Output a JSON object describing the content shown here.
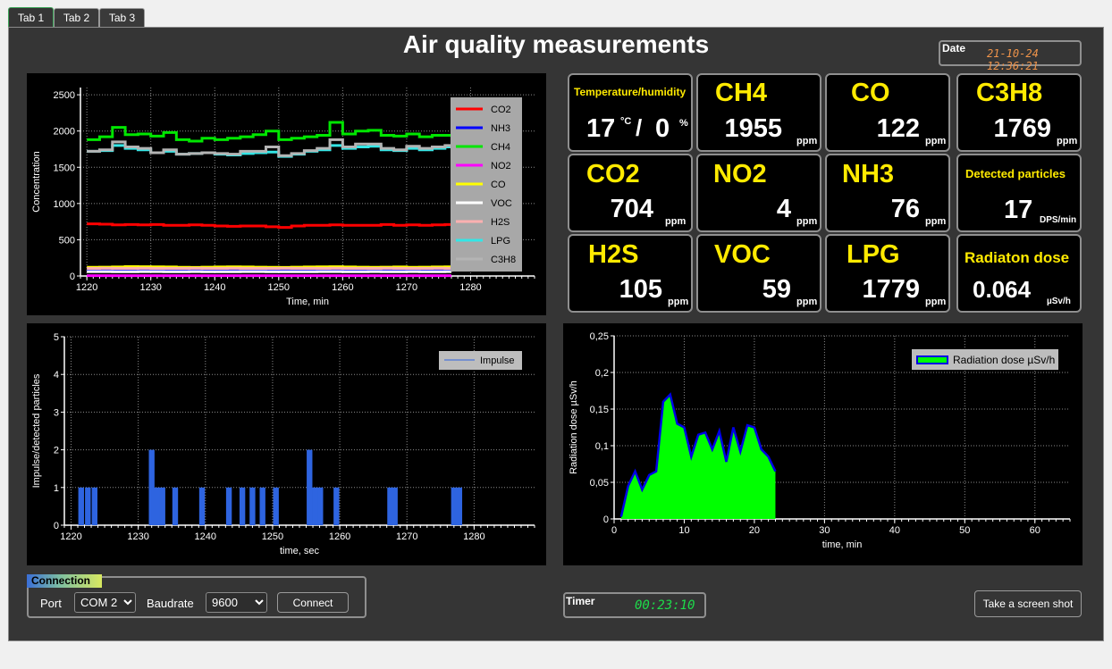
{
  "tabs": [
    {
      "label": "Tab 1"
    },
    {
      "label": "Tab 2"
    },
    {
      "label": "Tab 3"
    }
  ],
  "title": "Air quality measurements",
  "date": {
    "label": "Date",
    "value": "21-10-24 12:36:21",
    "color": "#f0944a"
  },
  "tiles": [
    {
      "name": "CH4",
      "value": "1955",
      "unit": "ppm"
    },
    {
      "name": "CO",
      "value": "122",
      "unit": "ppm"
    },
    {
      "name": "C3H8",
      "value": "1769",
      "unit": "ppm"
    },
    {
      "name": "CO2",
      "value": "704",
      "unit": "ppm"
    },
    {
      "name": "NO2",
      "value": "4",
      "unit": "ppm"
    },
    {
      "name": "NH3",
      "value": "76",
      "unit": "ppm"
    },
    {
      "name": "H2S",
      "value": "105",
      "unit": "ppm"
    },
    {
      "name": "VOC",
      "value": "59",
      "unit": "ppm"
    },
    {
      "name": "LPG",
      "value": "1779",
      "unit": "ppm"
    }
  ],
  "temperature": {
    "label": "Temperature/humidity",
    "temp": "17",
    "temp_unit": "°C",
    "sep": "/",
    "hum": "0",
    "hum_unit": "%"
  },
  "particles": {
    "label": "Detected particles",
    "value": "17",
    "unit": "DPS/min"
  },
  "radiation": {
    "label": "Radiaton dose",
    "value": "0.064",
    "unit": "µSv/h"
  },
  "connection": {
    "title": "Connection",
    "port_label": "Port",
    "port_value": "COM 2",
    "baud_label": "Baudrate",
    "baud_value": "9600",
    "connect_label": "Connect"
  },
  "timer": {
    "label": "Timer",
    "value": "00:23:10",
    "color": "#1ddc4a"
  },
  "screenshot_label": "Take  a screen  shot",
  "chart_data": [
    {
      "type": "line",
      "title": "",
      "xlabel": "Time, min",
      "ylabel": "Concentration",
      "xlim": [
        1219,
        1290
      ],
      "ylim": [
        0,
        2600
      ],
      "xticks": [
        1220,
        1230,
        1240,
        1250,
        1260,
        1270,
        1280
      ],
      "yticks": [
        0,
        500,
        1000,
        1500,
        2000,
        2500
      ],
      "grid": true,
      "legend_position": "top-right",
      "x": [
        1220,
        1222,
        1224,
        1226,
        1228,
        1230,
        1232,
        1234,
        1236,
        1238,
        1240,
        1242,
        1244,
        1246,
        1248,
        1250,
        1252,
        1254,
        1256,
        1258,
        1260,
        1262,
        1264,
        1266,
        1268,
        1270,
        1272,
        1274,
        1276,
        1277
      ],
      "series": [
        {
          "name": "CO2",
          "color": "#ff0000",
          "values": [
            720,
            715,
            705,
            710,
            705,
            710,
            700,
            700,
            705,
            700,
            690,
            685,
            690,
            690,
            680,
            670,
            690,
            700,
            700,
            705,
            700,
            700,
            700,
            710,
            700,
            705,
            700,
            705,
            710,
            704
          ]
        },
        {
          "name": "NH3",
          "color": "#0000ff",
          "values": [
            78,
            78,
            77,
            77,
            76,
            76,
            76,
            77,
            76,
            76,
            76,
            76,
            75,
            76,
            76,
            76,
            76,
            76,
            76,
            76,
            76,
            76,
            76,
            76,
            76,
            76,
            76,
            76,
            76,
            76
          ]
        },
        {
          "name": "CH4",
          "color": "#00e600",
          "values": [
            1880,
            1920,
            2050,
            1950,
            1960,
            1930,
            1980,
            1880,
            1860,
            1900,
            1880,
            1900,
            1920,
            1950,
            2000,
            1880,
            1900,
            1920,
            1940,
            2120,
            1960,
            2000,
            2010,
            1940,
            1930,
            1960,
            1920,
            1940,
            1940,
            1955
          ]
        },
        {
          "name": "NO2",
          "color": "#ff00ff",
          "values": [
            4,
            4,
            4,
            4,
            4,
            4,
            4,
            4,
            4,
            4,
            4,
            4,
            4,
            4,
            4,
            4,
            4,
            4,
            4,
            4,
            4,
            4,
            4,
            4,
            4,
            4,
            4,
            4,
            4,
            4
          ]
        },
        {
          "name": "CO",
          "color": "#ffff00",
          "values": [
            120,
            122,
            125,
            130,
            128,
            126,
            124,
            120,
            118,
            122,
            124,
            126,
            124,
            122,
            120,
            118,
            122,
            124,
            126,
            128,
            124,
            122,
            120,
            122,
            124,
            120,
            122,
            124,
            126,
            122
          ]
        },
        {
          "name": "VOC",
          "color": "#ffffff",
          "values": [
            60,
            60,
            59,
            59,
            60,
            60,
            59,
            59,
            60,
            59,
            58,
            59,
            60,
            60,
            59,
            58,
            59,
            59,
            60,
            60,
            59,
            59,
            60,
            59,
            59,
            60,
            59,
            59,
            60,
            59
          ]
        },
        {
          "name": "H2S",
          "color": "#ffb0b0",
          "values": [
            105,
            106,
            104,
            105,
            106,
            105,
            104,
            105,
            106,
            104,
            105,
            106,
            105,
            104,
            105,
            106,
            105,
            104,
            105,
            106,
            105,
            104,
            105,
            106,
            105,
            104,
            105,
            106,
            105,
            105
          ]
        },
        {
          "name": "LPG",
          "color": "#33e6e6",
          "values": [
            1720,
            1730,
            1800,
            1760,
            1740,
            1700,
            1720,
            1680,
            1690,
            1700,
            1680,
            1670,
            1690,
            1700,
            1710,
            1650,
            1680,
            1720,
            1740,
            1800,
            1760,
            1780,
            1790,
            1740,
            1730,
            1760,
            1740,
            1760,
            1780,
            1779
          ]
        },
        {
          "name": "C3H8",
          "color": "#b4b4b4",
          "values": [
            1720,
            1740,
            1850,
            1780,
            1760,
            1700,
            1740,
            1680,
            1690,
            1700,
            1690,
            1680,
            1720,
            1720,
            1780,
            1660,
            1690,
            1730,
            1760,
            1880,
            1780,
            1820,
            1820,
            1760,
            1740,
            1790,
            1760,
            1780,
            1800,
            1769
          ]
        }
      ]
    },
    {
      "type": "bar",
      "title": "",
      "xlabel": "time, sec",
      "ylabel": "Impulse/detected particles",
      "xlim": [
        1219,
        1289
      ],
      "ylim": [
        0,
        5
      ],
      "xticks": [
        1220,
        1230,
        1240,
        1250,
        1260,
        1270,
        1280
      ],
      "yticks": [
        0,
        1,
        2,
        3,
        4,
        5
      ],
      "grid": true,
      "legend_position": "top-right",
      "series": [
        {
          "name": "Impulse",
          "color": "#2e64e0"
        }
      ],
      "points": [
        [
          1221.5,
          1
        ],
        [
          1222.5,
          1
        ],
        [
          1223.5,
          1
        ],
        [
          1232,
          2
        ],
        [
          1232.8,
          1
        ],
        [
          1233.6,
          1
        ],
        [
          1235.5,
          1
        ],
        [
          1239.5,
          1
        ],
        [
          1243.5,
          1
        ],
        [
          1245.5,
          1
        ],
        [
          1247,
          1
        ],
        [
          1248.5,
          1
        ],
        [
          1250.5,
          1
        ],
        [
          1255.5,
          2
        ],
        [
          1256.3,
          1
        ],
        [
          1257.1,
          1
        ],
        [
          1259.5,
          1
        ],
        [
          1267.5,
          1
        ],
        [
          1268.2,
          1
        ],
        [
          1277,
          1
        ],
        [
          1277.8,
          1
        ]
      ]
    },
    {
      "type": "area",
      "title": "",
      "xlabel": "time, min",
      "ylabel": "Radiation dose µSv/h",
      "xlim": [
        0,
        65
      ],
      "ylim": [
        0,
        0.25
      ],
      "xticks": [
        0,
        10,
        20,
        30,
        40,
        50,
        60
      ],
      "yticks": [
        "0",
        "0,05",
        "0,1",
        "0,15",
        "0,2",
        "0,25"
      ],
      "grid": true,
      "legend_position": "top-right",
      "series": [
        {
          "name": "Radiation dose µSv/h",
          "fill": "#00ff00",
          "line": "#0000e6"
        }
      ],
      "x": [
        1,
        2,
        3,
        4,
        5,
        6,
        7,
        8,
        9,
        10,
        11,
        12,
        13,
        14,
        15,
        16,
        17,
        18,
        19,
        20,
        21,
        22,
        23
      ],
      "values": [
        0.003,
        0.045,
        0.065,
        0.04,
        0.06,
        0.065,
        0.16,
        0.17,
        0.13,
        0.125,
        0.085,
        0.115,
        0.118,
        0.095,
        0.12,
        0.078,
        0.125,
        0.092,
        0.128,
        0.125,
        0.095,
        0.085,
        0.065
      ]
    }
  ]
}
